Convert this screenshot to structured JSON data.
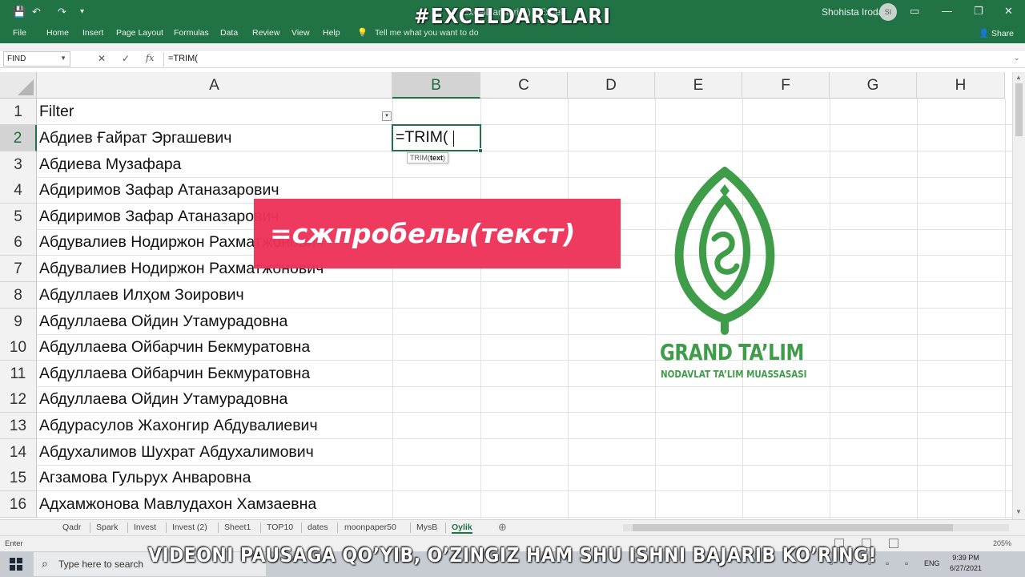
{
  "titlebar": {
    "qa_save": "💾",
    "qa_undo": "↶",
    "qa_redo": "↷",
    "qa_more": "▾",
    "doc_title": "ExcelDarslari(1) - Excel",
    "user": "Shohista Iroda",
    "avatar_initials": "SI",
    "win_ribbon": "▭",
    "win_min": "—",
    "win_restore": "❐",
    "win_close": "✕"
  },
  "hashtag": "#EXCELDARSLARI",
  "ribbon": {
    "tabs": [
      "File",
      "Home",
      "Insert",
      "Page Layout",
      "Formulas",
      "Data",
      "Review",
      "View",
      "Help"
    ],
    "tell_me": "Tell me what you want to do",
    "share": "Share"
  },
  "formula_bar": {
    "name_box": "FIND",
    "cancel": "✕",
    "enter": "✓",
    "fx": "fx",
    "formula": "=TRIM("
  },
  "columns": [
    "A",
    "B",
    "C",
    "D",
    "E",
    "F",
    "G",
    "H"
  ],
  "rows": [
    {
      "num": "1",
      "a": "Filter"
    },
    {
      "num": "2",
      "a": "Абдиев Ғайрат Эргашевич"
    },
    {
      "num": "3",
      "a": "Абдиева Музафара"
    },
    {
      "num": "4",
      "a": "Абдиримов  Зафар Атаназарович"
    },
    {
      "num": "5",
      "a": "Абдиримов Зафар Атаназарович"
    },
    {
      "num": "6",
      "a": "Абдувалиев Нодиржон Рахматжонович"
    },
    {
      "num": "7",
      "a": "Абдувалиев Нодиржон Рахматжонович"
    },
    {
      "num": "8",
      "a": "Абдуллаев Илҳом Зоирович"
    },
    {
      "num": "9",
      "a": "Абдуллаева  Ойдин Утамурадовна"
    },
    {
      "num": "10",
      "a": "Абдуллаева Ойбарчин Бекмуратовна"
    },
    {
      "num": "11",
      "a": "Абдуллаева Ойбарчин Бекмуратовна"
    },
    {
      "num": "12",
      "a": "Абдуллаева Ойдин Утамурадовна"
    },
    {
      "num": "13",
      "a": "Абдурасулов Жахонгир Абдувалиевич"
    },
    {
      "num": "14",
      "a": "Абдухалимов Шухрат Абдухалимович"
    },
    {
      "num": "15",
      "a": "Агзамова Гульрух Анваровна"
    },
    {
      "num": "16",
      "a": "Адхамжонова Мавлудахон Хамзаевна"
    }
  ],
  "active_cell": {
    "content": "=TRIM(",
    "tooltip_fn": "TRIM(",
    "tooltip_arg": "text",
    "tooltip_close": ")"
  },
  "banner": "=сжпробелы(текст)",
  "logo": {
    "name": "GRAND TA’LIM",
    "subtitle": "NODAVLAT TA’LIM MUASSASASI",
    "color": "#3f9c48"
  },
  "sheets": {
    "tabs": [
      "Qadr",
      "Spark",
      "Invest",
      "Invest (2)",
      "Sheet1",
      "TOP10",
      "dates",
      "moonpaper50",
      "MysB",
      "Oylik"
    ],
    "active": "Oylik",
    "add": "⊕"
  },
  "status": {
    "mode": "Enter",
    "zoom": "205%"
  },
  "taskbar": {
    "search_placeholder": "Type here to search",
    "lang": "ENG",
    "time": "9:39 PM",
    "date": "6/27/2021"
  },
  "caption": "VIDEONI PAUSAGA QO’YIB, O’ZINGIZ HAM SHU ISHNI BAJARIB KO’RING!",
  "colors": {
    "excel_green": "#217346",
    "banner_pink": "#ee3258"
  }
}
